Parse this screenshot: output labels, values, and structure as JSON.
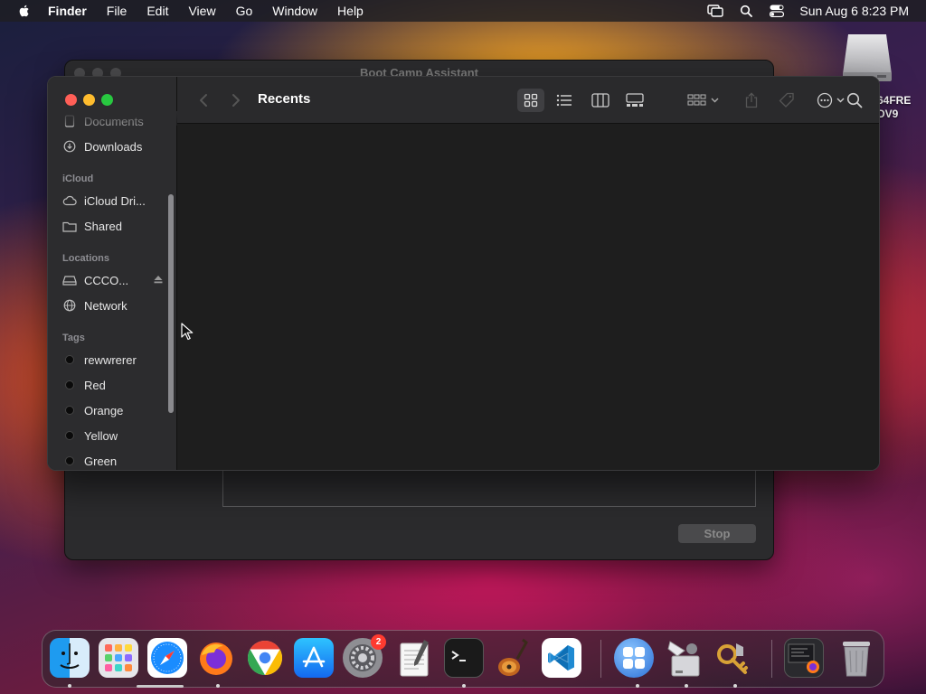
{
  "menubar": {
    "app_name": "Finder",
    "items": [
      "File",
      "Edit",
      "View",
      "Go",
      "Window",
      "Help"
    ],
    "clock": "Sun Aug 6  8:23 PM",
    "status_icons": [
      "screen-mirroring-icon",
      "spotlight-search-icon",
      "control-center-icon"
    ]
  },
  "desktop": {
    "drive_label_line1": "64FRE",
    "drive_label_line2": "DV9"
  },
  "bootcamp_window": {
    "title": "Boot Camp Assistant",
    "stop_label": "Stop"
  },
  "finder": {
    "title": "Recents",
    "sidebar": {
      "partial_top": "Documents",
      "downloads": "Downloads",
      "icloud_heading": "iCloud",
      "icloud_drive": "iCloud Dri...",
      "shared": "Shared",
      "locations_heading": "Locations",
      "disk": "CCCO...",
      "network": "Network",
      "tags_heading": "Tags",
      "tags": [
        "rewwrerer",
        "Red",
        "Orange",
        "Yellow",
        "Green"
      ]
    }
  },
  "dock": {
    "apps": [
      "Finder",
      "Launchpad",
      "Safari",
      "Firefox",
      "Google Chrome",
      "App Store",
      "System Settings",
      "TextEdit",
      "Terminal",
      "GarageBand",
      "Visual Studio Code",
      "Boot Camp Assistant",
      "Disk Utility",
      "Keychain Access",
      "Downloads",
      "Trash"
    ],
    "settings_badge": "2"
  },
  "colors": {
    "close": "#ff5f57",
    "minimize": "#febc2e",
    "zoom": "#28c840",
    "badge": "#ff3b30"
  }
}
